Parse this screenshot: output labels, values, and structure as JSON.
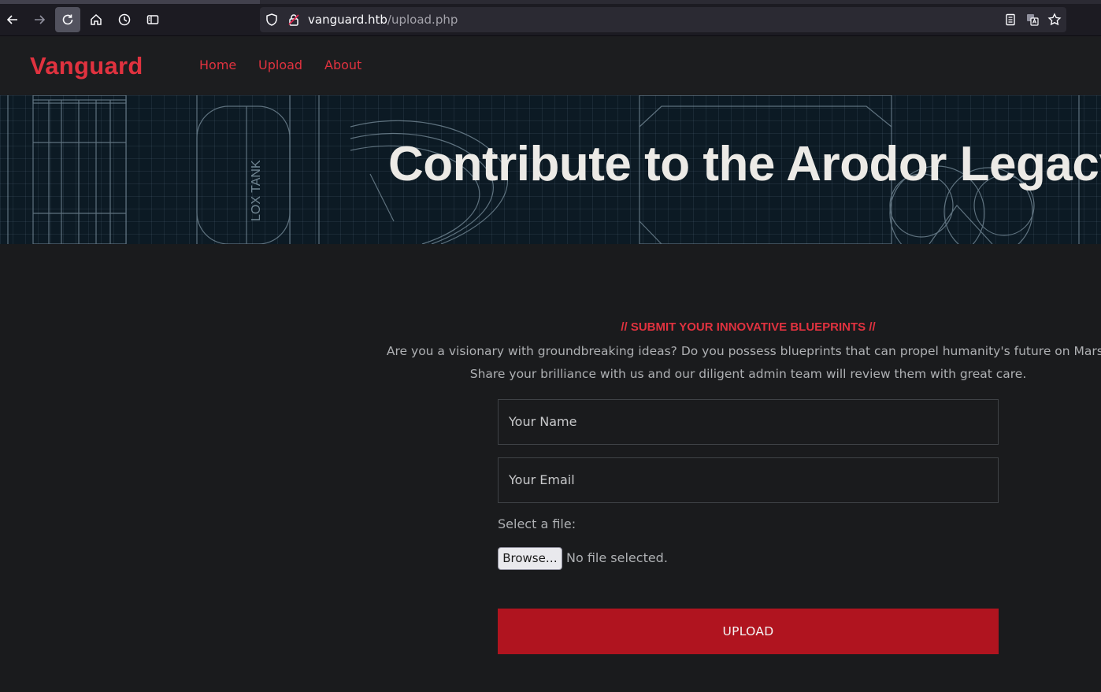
{
  "browser": {
    "url_host": "vanguard.htb",
    "url_path": "/upload.php",
    "icons": [
      "back-icon",
      "forward-icon",
      "reload-icon",
      "home-icon",
      "history-icon",
      "sidebar-icon",
      "shield-icon",
      "lock-icon",
      "reader-mode-icon",
      "translate-icon",
      "bookmark-star-icon"
    ]
  },
  "header": {
    "brand": "Vanguard",
    "nav": [
      {
        "label": "Home"
      },
      {
        "label": "Upload"
      },
      {
        "label": "About"
      }
    ]
  },
  "hero": {
    "title": "Contribute to the Arodor Legacy",
    "blueprint_label": "LOX TANK"
  },
  "form": {
    "kicker": "// SUBMIT YOUR INNOVATIVE BLUEPRINTS //",
    "description_line1": "Are you a visionary with groundbreaking ideas? Do you possess blueprints that can propel humanity's future on Mars?",
    "description_line2": "Share your brilliance with us and our diligent admin team will review them with great care.",
    "name_placeholder": "Your Name",
    "email_placeholder": "Your Email",
    "file_label": "Select a file:",
    "browse_label": "Browse…",
    "no_file_text": "No file selected.",
    "submit_label": "UPLOAD"
  },
  "colors": {
    "accent": "#e0323f",
    "button": "#b0141f",
    "background": "#1a1b1d"
  }
}
